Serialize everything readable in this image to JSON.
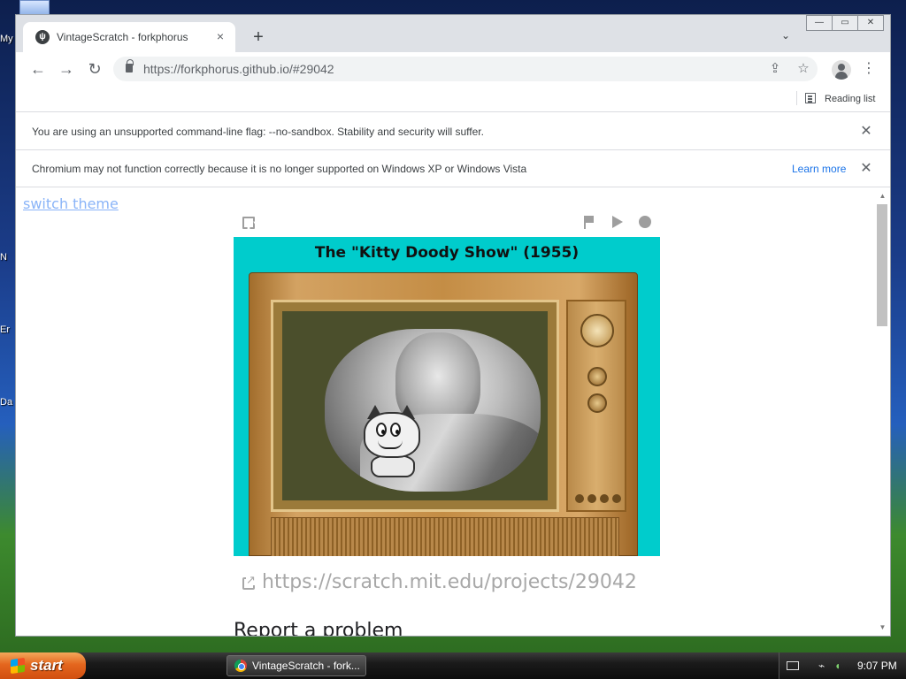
{
  "desktop": {
    "labels": [
      "My",
      "N",
      "Er",
      "Da"
    ]
  },
  "window": {
    "tab_title": "VintageScratch - forkphorus",
    "tab_close": "×",
    "new_tab": "+",
    "tab_search": "⌄",
    "minimize": "—",
    "maximize": "▭",
    "close": "✕"
  },
  "toolbar": {
    "back": "←",
    "forward": "→",
    "reload": "↻",
    "url": "https://forkphorus.github.io/#29042",
    "share": "⇪",
    "bookmark": "☆",
    "menu": "⋮"
  },
  "bookmarks": {
    "reading_list": "Reading list"
  },
  "infobars": [
    {
      "message": "You are using an unsupported command-line flag: --no-sandbox. Stability and security will suffer.",
      "close": "✕"
    },
    {
      "message": "Chromium may not function correctly because it is no longer supported on Windows XP or Windows Vista",
      "link": "Learn more",
      "close": "✕"
    }
  ],
  "content": {
    "switch_theme": "switch theme",
    "stage_title": "The \"Kitty Doody Show\" (1955)",
    "project_link": "https://scratch.mit.edu/projects/29042",
    "report": "Report a problem"
  },
  "scrollbar": {
    "up": "▲",
    "down": "▼"
  },
  "taskbar": {
    "start": "start",
    "task_item": "VintageScratch - fork...",
    "clock": "9:07 PM"
  },
  "colors": {
    "stage_bg": "#00cccc",
    "start_button": "#e4661e",
    "link_blue": "#1a73e8",
    "switch_theme": "#8ab4f8"
  },
  "icons": [
    "fullscreen-icon",
    "green-flag-icon",
    "play-icon",
    "stop-icon",
    "external-link-icon",
    "lock-icon",
    "share-icon",
    "star-icon",
    "profile-icon",
    "reading-list-icon"
  ]
}
